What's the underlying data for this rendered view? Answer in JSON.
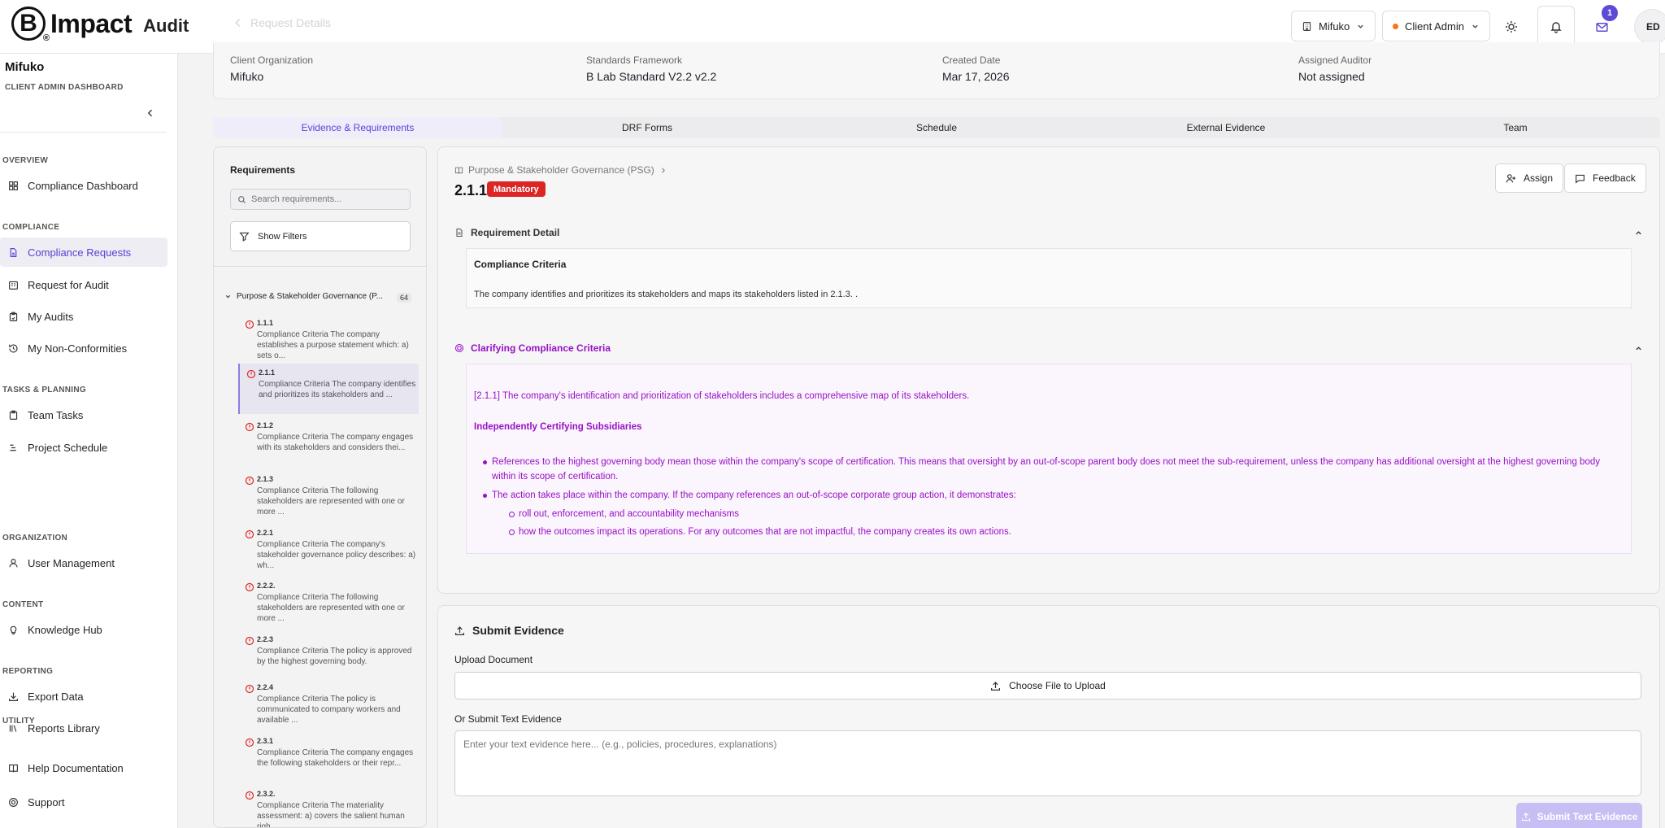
{
  "header": {
    "logo_mark": "B",
    "logo_text": "Impact",
    "logo_sub": "Audit",
    "ghost_text": "Request Details",
    "org_select": "Mifuko",
    "role_select": "Client Admin",
    "mail_count": "1",
    "avatar_initials": "ED"
  },
  "sidebar": {
    "org_name": "Mifuko",
    "org_role": "CLIENT ADMIN DASHBOARD",
    "sections": {
      "overview": "OVERVIEW",
      "compliance": "COMPLIANCE",
      "tasks": "TASKS & PLANNING",
      "organization": "ORGANIZATION",
      "content": "CONTENT",
      "reporting": "REPORTING",
      "utility": "UTILITY"
    },
    "items": {
      "compliance_dashboard": "Compliance Dashboard",
      "compliance_requests": "Compliance Requests",
      "request_audit": "Request for Audit",
      "my_audits": "My Audits",
      "non_conformities": "My Non-Conformities",
      "team_tasks": "Team Tasks",
      "project_schedule": "Project Schedule",
      "user_management": "User Management",
      "knowledge_hub": "Knowledge Hub",
      "export_data": "Export Data",
      "reports_library": "Reports Library",
      "help_docs": "Help Documentation",
      "support": "Support"
    }
  },
  "info": {
    "client_org_label": "Client Organization",
    "client_org": "Mifuko",
    "framework_label": "Standards Framework",
    "framework": "B Lab Standard V2.2 v2.2",
    "created_label": "Created Date",
    "created": "Mar 17, 2026",
    "auditor_label": "Assigned Auditor",
    "auditor": "Not assigned"
  },
  "tabs": [
    "Evidence & Requirements",
    "DRF Forms",
    "Schedule",
    "External Evidence",
    "Team"
  ],
  "requirements": {
    "title": "Requirements",
    "search_placeholder": "Search requirements...",
    "filter_label": "Show Filters",
    "group_label": "Purpose & Stakeholder Governance (P...",
    "group_count": "64",
    "items": [
      {
        "code": "1.1.1",
        "text": "Compliance Criteria The company establishes a purpose statement which: a) sets o..."
      },
      {
        "code": "2.1.1",
        "text": "Compliance Criteria The company identifies and prioritizes its stakeholders and ..."
      },
      {
        "code": "2.1.2",
        "text": "Compliance Criteria The company engages with its stakeholders and considers thei..."
      },
      {
        "code": "2.1.3",
        "text": "Compliance Criteria The following stakeholders are represented with one or more ..."
      },
      {
        "code": "2.2.1",
        "text": "Compliance Criteria The company's stakeholder governance policy describes: a) wh..."
      },
      {
        "code": "2.2.2.",
        "text": "Compliance Criteria The following stakeholders are represented with one or more ..."
      },
      {
        "code": "2.2.3",
        "text": "Compliance Criteria The policy is approved by the highest governing body."
      },
      {
        "code": "2.2.4",
        "text": "Compliance Criteria The policy is communicated to company workers and available ..."
      },
      {
        "code": "2.3.1",
        "text": "Compliance Criteria The company engages the following stakeholders or their repr..."
      },
      {
        "code": "2.3.2.",
        "text": "Compliance Criteria The materiality assessment: a) covers the salient human righ..."
      }
    ]
  },
  "detail": {
    "breadcrumb": "Purpose & Stakeholder Governance (PSG)",
    "code": "2.1.1",
    "badge": "Mandatory",
    "assign": "Assign",
    "feedback": "Feedback",
    "req_detail_title": "Requirement Detail",
    "criteria_title": "Compliance Criteria",
    "criteria_text": "The company identifies and prioritizes its stakeholders and maps its stakeholders listed in 2.1.3. .",
    "clar_title": "Clarifying Compliance Criteria",
    "clar_intro": "[2.1.1] The company's identification and prioritization of stakeholders includes a comprehensive map of its stakeholders.",
    "clar_sub": "Independently Certifying Subsidiaries",
    "bullet1": "References to the highest governing body mean those within the company's scope of certification. This means that oversight by an out-of-scope parent body does not meet the sub-requirement, unless the company has additional oversight at the highest governing body within its scope of certification.",
    "bullet2": "The action takes place within the company. If the company references an out-of-scope corporate group action, it demonstrates:",
    "sub1": "roll out, enforcement, and accountability mechanisms",
    "sub2": "how the outcomes impact its operations. For any outcomes that are not impactful, the company creates its own actions."
  },
  "submit": {
    "title": "Submit Evidence",
    "upload_label": "Upload Document",
    "upload_btn": "Choose File to Upload",
    "text_label": "Or Submit Text Evidence",
    "text_placeholder": "Enter your text evidence here... (e.g., policies, procedures, explanations)",
    "submit_btn": "Submit Text Evidence"
  },
  "colors": {
    "accent": "#5b3fd6",
    "mandatory": "#dc2626",
    "clarifying": "#9810c4"
  }
}
